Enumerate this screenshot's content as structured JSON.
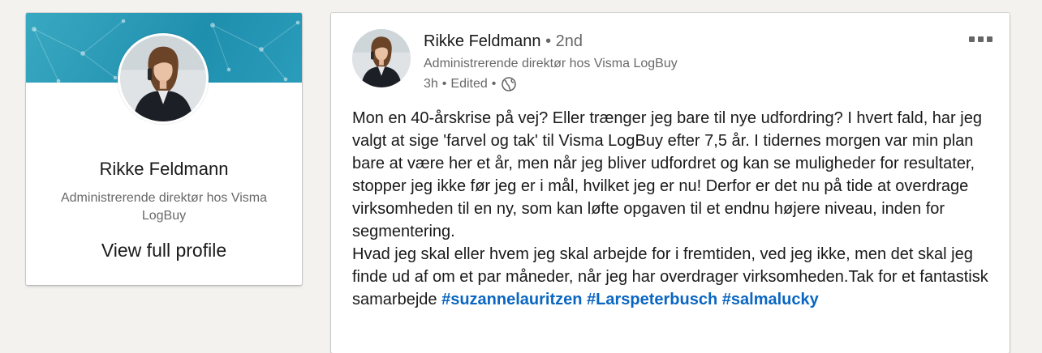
{
  "profile_card": {
    "name": "Rikke Feldmann",
    "headline": "Administrerende direktør hos Visma LogBuy",
    "view_profile_label": "View full profile"
  },
  "post": {
    "author_name": "Rikke Feldmann",
    "bullet": "•",
    "degree": "2nd",
    "author_headline": "Administrerende direktør hos Visma LogBuy",
    "time": "3h",
    "edited": "Edited",
    "paragraph_1": "Mon en 40-årskrise på vej? Eller trænger jeg bare til nye udfordring? I hvert fald, har jeg valgt at sige 'farvel og tak' til Visma LogBuy efter 7,5 år. I tidernes morgen var min plan bare at være her et år, men når jeg bliver udfordret og kan se muligheder for resultater, stopper jeg ikke før jeg er i mål, hvilket jeg er nu! Derfor er det nu på tide at overdrage virksomheden til en ny, som kan løfte opgaven til et endnu højere niveau, inden for segmentering.",
    "paragraph_2": "Hvad jeg skal eller hvem jeg skal arbejde for i fremtiden, ved jeg ikke, men det skal jeg finde ud af om et par måneder, når jeg har overdrager virksomheden.Tak for et fantastisk samarbejde",
    "hashtags": [
      "#suzannelauritzen",
      "#Larspeterbusch",
      "#salmalucky"
    ],
    "visibility_icon": "globe-icon",
    "menu_icon": "more-options-icon"
  },
  "colors": {
    "background": "#f3f2ef",
    "banner": "#1f8fae",
    "hashtag": "#0a66c2"
  }
}
